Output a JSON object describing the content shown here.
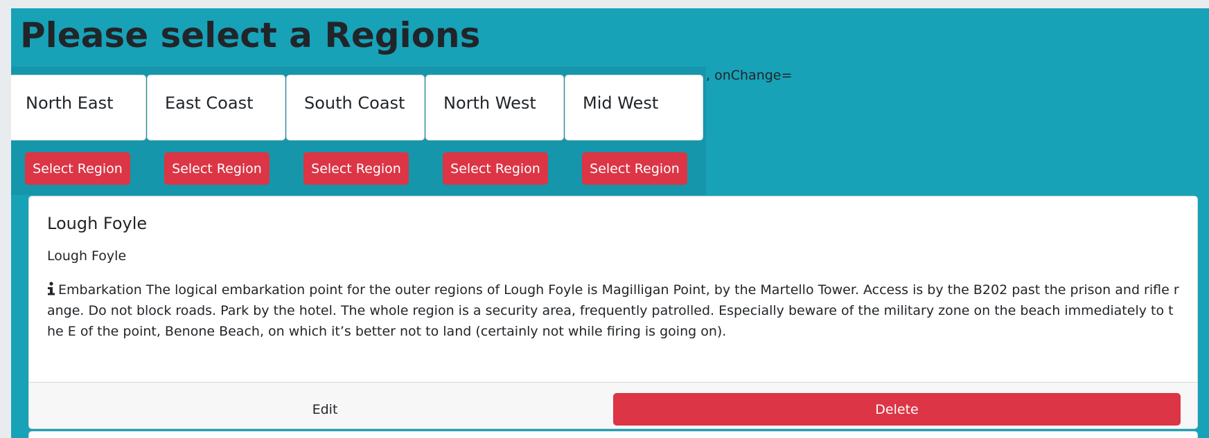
{
  "page": {
    "title": "Please select a Regions",
    "stray_text": ", onChange="
  },
  "regions": [
    {
      "name": "North East",
      "button_label": "Select Region"
    },
    {
      "name": "East Coast",
      "button_label": "Select Region"
    },
    {
      "name": "South Coast",
      "button_label": "Select Region"
    },
    {
      "name": "North West",
      "button_label": "Select Region"
    },
    {
      "name": "Mid West",
      "button_label": "Select Region"
    }
  ],
  "entry": {
    "title": "Lough Foyle",
    "subtitle": "Lough Foyle",
    "icon": "info-icon",
    "text": "Embarkation The logical embarkation point for the outer regions of Lough Foyle is Magilligan Point, by the Martello Tower. Access is by the B202 past the prison and rifle range. Do not block roads. Park by the hotel. The whole region is a security area, frequently patrolled. Especially beware of the military zone on the beach immediately to the E of the point, Benone Beach, on which it’s better not to land (certainly not while firing is going on).",
    "edit_label": "Edit",
    "delete_label": "Delete"
  },
  "colors": {
    "background": "#17a2b8",
    "danger": "#dc3545"
  }
}
